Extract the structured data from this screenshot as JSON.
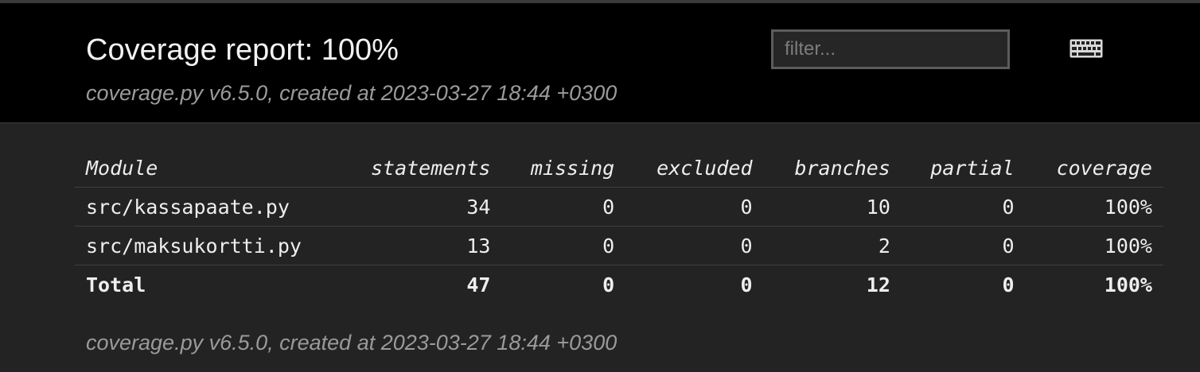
{
  "header": {
    "title": "Coverage report: 100%",
    "created": "coverage.py v6.5.0, created at 2023-03-27 18:44 +0300"
  },
  "filter": {
    "placeholder": "filter...",
    "value": ""
  },
  "keyboard_icon": "keyboard-icon",
  "table": {
    "columns": [
      "Module",
      "statements",
      "missing",
      "excluded",
      "branches",
      "partial",
      "coverage"
    ],
    "rows": [
      {
        "module": "src/kassapaate.py",
        "statements": "34",
        "missing": "0",
        "excluded": "0",
        "branches": "10",
        "partial": "0",
        "coverage": "100%"
      },
      {
        "module": "src/maksukortti.py",
        "statements": "13",
        "missing": "0",
        "excluded": "0",
        "branches": "2",
        "partial": "0",
        "coverage": "100%"
      }
    ],
    "total": {
      "module": "Total",
      "statements": "47",
      "missing": "0",
      "excluded": "0",
      "branches": "12",
      "partial": "0",
      "coverage": "100%"
    }
  },
  "footer": {
    "created": "coverage.py v6.5.0, created at 2023-03-27 18:44 +0300"
  }
}
